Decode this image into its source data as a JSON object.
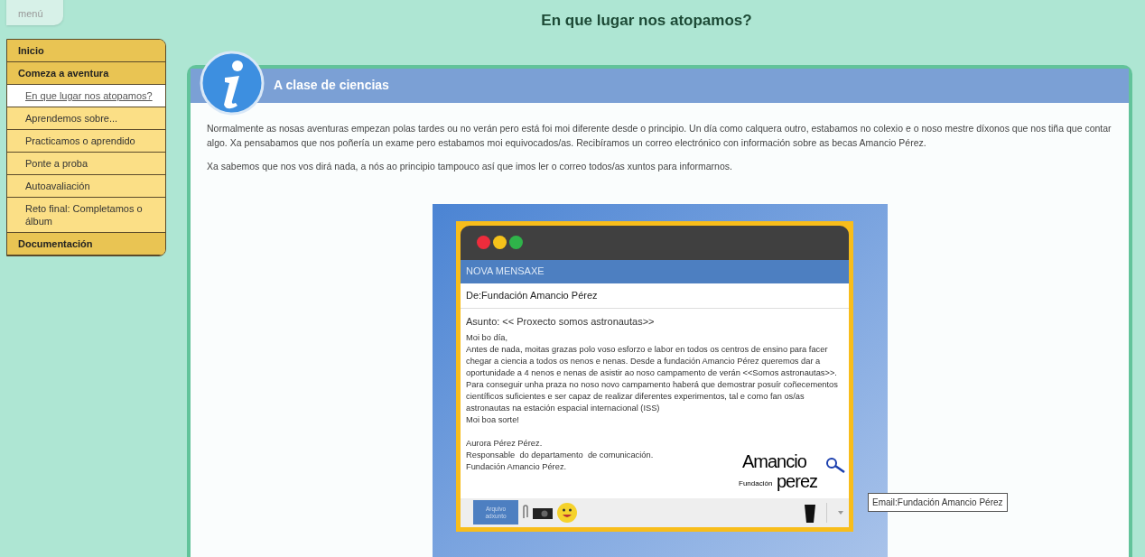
{
  "menu_button": "menú",
  "page_title": "En que lugar nos atopamos?",
  "sidebar": {
    "items": [
      {
        "label": "Inicio",
        "kind": "section",
        "selected": false
      },
      {
        "label": "Comeza a aventura",
        "kind": "section",
        "selected": false
      },
      {
        "label": "En que lugar nos atopamos?",
        "kind": "page",
        "selected": true
      },
      {
        "label": "Aprendemos sobre...",
        "kind": "page",
        "selected": false
      },
      {
        "label": "Practicamos o aprendido",
        "kind": "page",
        "selected": false
      },
      {
        "label": "Ponte a proba",
        "kind": "page",
        "selected": false
      },
      {
        "label": "Autoavaliación",
        "kind": "page",
        "selected": false
      },
      {
        "label": "Reto final: Completamos o álbum",
        "kind": "page",
        "selected": false
      },
      {
        "label": "Documentación",
        "kind": "section",
        "selected": false
      }
    ]
  },
  "panel": {
    "title": "A clase de ciencias",
    "paragraphs": [
      "Normalmente as nosas aventuras empezan polas tardes ou no verán pero está foi moi diferente desde o principio. Un día como calquera  outro, estabamos no colexio e o noso mestre díxonos que nos tiña que contar algo. Xa pensabamos que nos poñería un exame pero estabamos moi equivocados/as. Recibíramos un correo electrónico con información sobre as becas Amancio Pérez.",
      "Xa sabemos que nos vos dirá nada, a nós ao principio tampouco así que imos ler o correo todos/as xuntos para informarnos."
    ]
  },
  "email": {
    "header": "NOVA MENSAXE",
    "from": "De:Fundación Amancio Pérez",
    "subject": "Asunto: << Proxecto somos astronautas>>",
    "body": [
      "Moi bo día,",
      " Antes de nada, moitas grazas polo voso esforzo e labor en todos os centros de ensino para facer chegar a ciencia a todos os nenos e nenas. Desde a fundación Amancio Pérez queremos dar a oportunidade a 4 nenos e nenas de asistir ao noso campamento de verán <<Somos astronautas>>. Para conseguir unha praza no noso novo campamento haberá que demostrar posuír coñecementos científicos suficientes e ser capaz de realizar diferentes experimentos, tal e como fan os/as astronautas na estación espacial internacional (ISS)",
      "Moi boa sorte!"
    ],
    "signature": [
      "Aurora Pérez Pérez.",
      "Responsable  do departamento  de comunicación.",
      "Fundación Amancio Pérez."
    ],
    "logo": {
      "top": "Amancio",
      "bottom": "perez",
      "small": "Fundación"
    },
    "attach_button": "Arquivo adxunto"
  },
  "tooltip": "Email:Fundación Amancio Pérez"
}
